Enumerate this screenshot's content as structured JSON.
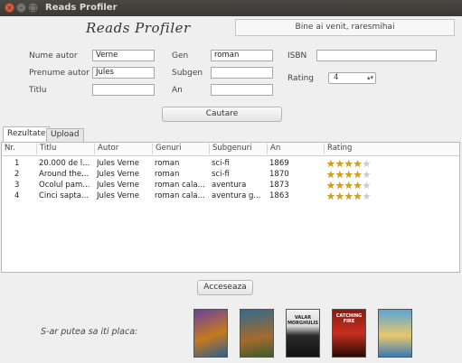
{
  "window": {
    "title": "Reads Profiler",
    "controls": [
      "×",
      "–",
      "□"
    ]
  },
  "header": {
    "logo": "Reads Profiler",
    "welcome": "Bine ai venit, raresmihai"
  },
  "form": {
    "nume_autor": {
      "label": "Nume autor",
      "value": "Verne"
    },
    "prenume_autor": {
      "label": "Prenume autor",
      "value": "Jules"
    },
    "titlu": {
      "label": "Titlu",
      "value": ""
    },
    "gen": {
      "label": "Gen",
      "value": "roman"
    },
    "subgen": {
      "label": "Subgen",
      "value": ""
    },
    "an": {
      "label": "An",
      "value": ""
    },
    "isbn": {
      "label": "ISBN",
      "value": ""
    },
    "rating": {
      "label": "Rating",
      "value": "4"
    },
    "search_label": "Cautare"
  },
  "tabs": [
    {
      "label": "Rezultate"
    },
    {
      "label": "Upload"
    }
  ],
  "table": {
    "headers": [
      "Nr.",
      "Titlu",
      "Autor",
      "Genuri",
      "Subgenuri",
      "An",
      "Rating"
    ],
    "rows": [
      {
        "nr": "1",
        "titlu": "20.000 de l...",
        "autor": "Jules Verne",
        "genuri": "roman",
        "subgenuri": "sci-fi",
        "an": "1869",
        "rating": 4
      },
      {
        "nr": "2",
        "titlu": "Around the...",
        "autor": "Jules Verne",
        "genuri": "roman",
        "subgenuri": "sci-fi",
        "an": "1870",
        "rating": 4
      },
      {
        "nr": "3",
        "titlu": "Ocolul pam...",
        "autor": "Jules Verne",
        "genuri": "roman cala...",
        "subgenuri": "aventura",
        "an": "1873",
        "rating": 4
      },
      {
        "nr": "4",
        "titlu": "Cinci sapta...",
        "autor": "Jules Verne",
        "genuri": "roman cala...",
        "subgenuri": "aventura g...",
        "an": "1863",
        "rating": 4
      }
    ],
    "max_rating": 5
  },
  "access_label": "Acceseaza",
  "suggestions": {
    "label": "S-ar putea sa iti placa:",
    "covers": [
      {
        "icon": "book-cover-icon",
        "text": ""
      },
      {
        "icon": "book-cover-icon",
        "text": ""
      },
      {
        "icon": "book-cover-icon",
        "text": "VALAR MORGHULIS"
      },
      {
        "icon": "book-cover-icon",
        "text": "CATCHING FIRE"
      },
      {
        "icon": "book-cover-icon",
        "text": ""
      }
    ]
  },
  "colors": {
    "star_on": "#d4a017",
    "star_off": "#c9c9c9",
    "close_button": "#e2603a"
  }
}
